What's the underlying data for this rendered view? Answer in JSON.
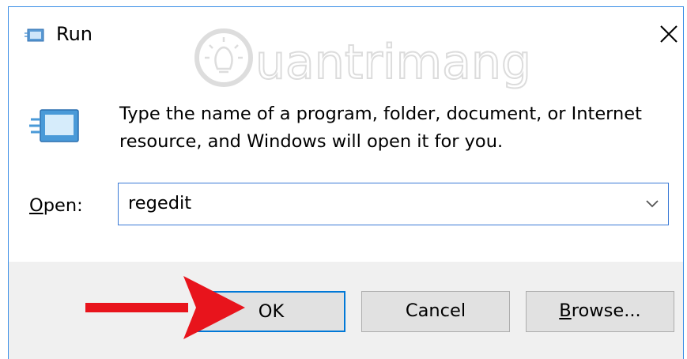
{
  "window": {
    "title": "Run",
    "close_glyph": "✕"
  },
  "watermark": {
    "text": "uantrimang"
  },
  "dialog": {
    "description": "Type the name of a program, folder, document, or Internet resource, and Windows will open it for you.",
    "open_label_hotkey": "O",
    "open_label_rest": "pen:",
    "open_value": "regedit"
  },
  "buttons": {
    "ok": "OK",
    "cancel": "Cancel",
    "browse_hotkey": "B",
    "browse_rest": "rowse..."
  },
  "colors": {
    "focus_border": "#0078d7",
    "annotation_arrow": "#e8141c"
  }
}
